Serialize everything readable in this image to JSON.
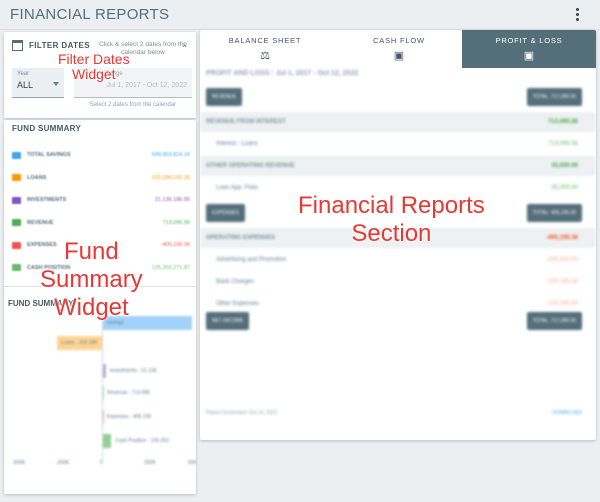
{
  "header": {
    "title": "FINANCIAL REPORTS",
    "menu_icon": "kebab-menu-icon"
  },
  "filter_dates": {
    "title": "FILTER DATES",
    "hint": "Click & select 2 dates from the calendar below",
    "year_label": "Year",
    "year_value": "ALL",
    "range_label": "Range",
    "range_value": "Jul 1, 2017 - Oct 12, 2022",
    "helper": "Select 2 dates from the calendar"
  },
  "fund_summary": {
    "title": "FUND SUMMARY",
    "items": [
      {
        "label": "TOTAL SAVINGS",
        "value": "599,903,824.16",
        "color": "#42a5f5"
      },
      {
        "label": "LOANS",
        "value": "102,186,192.35",
        "color": "#ff9800"
      },
      {
        "label": "INVESTMENTS",
        "value": "21,136,186.95",
        "color": "#7e57c2"
      },
      {
        "label": "REVENUE",
        "value": "713,095.56",
        "color": "#4caf50"
      },
      {
        "label": "EXPENSES",
        "value": "-405,195.36",
        "color": "#ef5350"
      },
      {
        "label": "CASH POSITION",
        "value": "125,202,271.87",
        "color": "#66bb6a"
      }
    ],
    "chart_title": "FUND SUMMARY",
    "chart_data": {
      "type": "bar",
      "categories": [
        "Savings",
        "Loans",
        "Investments",
        "Revenue",
        "Expenses",
        "Cash Position"
      ],
      "bars": [
        {
          "label": "Savings",
          "start": 0,
          "end": 500000,
          "color": "#90caf9"
        },
        {
          "label": "Loans - 102.186",
          "start": -250000,
          "end": 0,
          "color": "#ffcc80"
        },
        {
          "label": "Investments - 21.136",
          "start": 0,
          "end": 21136,
          "color": "#b39ddb"
        },
        {
          "label": "Revenue - 713.095",
          "start": 0,
          "end": 7131,
          "color": "#a5d6a7"
        },
        {
          "label": "Expenses - 405.195",
          "start": 0,
          "end": 4052,
          "color": "#ef9a9a"
        },
        {
          "label": "Cash Position - 125.202",
          "start": 0,
          "end": 52000,
          "color": "#81c784"
        }
      ],
      "x_ticks": [
        "-500K",
        "-250K",
        "0",
        "250K",
        "500K"
      ],
      "xlim": [
        -500000,
        500000
      ]
    }
  },
  "reports": {
    "tabs": [
      {
        "label": "BALANCE SHEET",
        "icon": "scale-icon"
      },
      {
        "label": "CASH FLOW",
        "icon": "cash-icon"
      },
      {
        "label": "PROFIT & LOSS",
        "icon": "money-icon"
      }
    ],
    "heading": "PROFIT AND LOSS : Jul 1, 2017 - Oct 12, 2022",
    "revenue_chip": "REVENUE",
    "revenue_total": "TOTAL: 717,095.56",
    "rows": [
      {
        "label": "REVENUE FROM INTEREST",
        "value": "713,095.56",
        "kind": "section",
        "color": "#43a047"
      },
      {
        "label": "Interest - Loans",
        "value": "713,095.56",
        "kind": "item",
        "color": "#66bb6a"
      },
      {
        "label": "OTHER OPERATING REVENUE",
        "value": "35,000.00",
        "kind": "section",
        "color": "#43a047"
      },
      {
        "label": "Loan App. Fees",
        "value": "35,000.00",
        "kind": "item",
        "color": "#66bb6a"
      }
    ],
    "expenses_chip": "EXPENSES",
    "expenses_total": "TOTAL: 405,195.36",
    "expense_rows": [
      {
        "label": "OPERATING EXPENSES",
        "value": "-405,195.36",
        "kind": "section",
        "color": "#f4511e"
      },
      {
        "label": "Advertising and Promotion",
        "value": "-200,000.00",
        "kind": "item",
        "color": "#ffab91"
      },
      {
        "label": "Bank Charges",
        "value": "-105,195.36",
        "kind": "item",
        "color": "#ffab91"
      },
      {
        "label": "Other Expenses",
        "value": "-100,000.00",
        "kind": "item",
        "color": "#ffab91"
      }
    ],
    "net_chip": "NET INCOME",
    "net_total": "TOTAL: 717,095.56",
    "footer": "Report Generated: Oct 14, 2022",
    "download": "DOWNLOAD"
  },
  "annotations": {
    "filter": [
      "Filter Dates",
      "Widget"
    ],
    "fund": [
      "Fund",
      "Summary",
      "Widget"
    ],
    "reports": [
      "Financial Reports",
      "Section"
    ]
  },
  "colors": {
    "accent": "#546e7a",
    "annotation": "#e53935"
  }
}
